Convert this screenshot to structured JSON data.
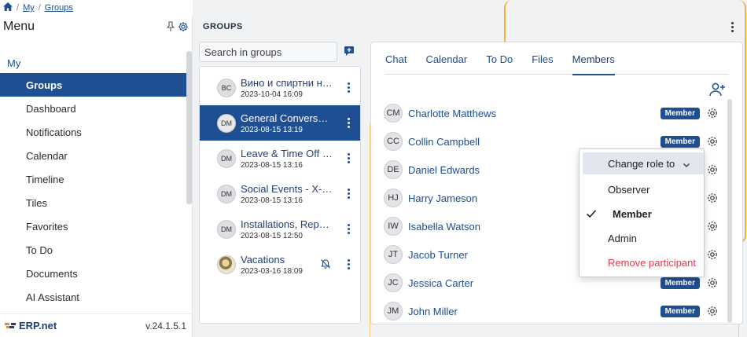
{
  "breadcrumb": {
    "home_icon": "home-icon",
    "items": [
      "My",
      "Groups"
    ],
    "separator": "/"
  },
  "sidebar": {
    "title": "Menu",
    "section": "My",
    "items": [
      {
        "label": "Groups",
        "active": true
      },
      {
        "label": "Dashboard"
      },
      {
        "label": "Notifications"
      },
      {
        "label": "Calendar"
      },
      {
        "label": "Timeline"
      },
      {
        "label": "Tiles"
      },
      {
        "label": "Favorites"
      },
      {
        "label": "To Do"
      },
      {
        "label": "Documents"
      },
      {
        "label": "AI Assistant"
      }
    ],
    "logo": "ERP.net",
    "version": "v.24.1.5.1"
  },
  "groups": {
    "title": "GROUPS",
    "search_placeholder": "Search in groups",
    "items": [
      {
        "avatar": "BC",
        "name": "Вино и спиртни напитки",
        "time": "2023-10-04 16:09"
      },
      {
        "avatar": "DM",
        "name": "General Conversation",
        "time": "2023-08-15 13:19",
        "active": true
      },
      {
        "avatar": "DM",
        "name": "Leave & Time Off - Requests",
        "time": "2023-08-15 13:16"
      },
      {
        "avatar": "DM",
        "name": "Social Events - X-Team",
        "time": "2023-08-15 13:16"
      },
      {
        "avatar": "DM",
        "name": "Installations, Repairs",
        "time": "2023-08-15 12:50"
      },
      {
        "avatar": "",
        "name": "Vacations",
        "time": "2023-03-16 18:09",
        "muted": true
      }
    ]
  },
  "tabs": [
    "Chat",
    "Calendar",
    "To Do",
    "Files",
    "Members"
  ],
  "active_tab": "Members",
  "members": [
    {
      "initials": "CM",
      "name": "Charlotte Matthews",
      "role": "Member"
    },
    {
      "initials": "CC",
      "name": "Collin Campbell",
      "role": "Member"
    },
    {
      "initials": "DE",
      "name": "Daniel Edwards",
      "role": ""
    },
    {
      "initials": "HJ",
      "name": "Harry Jameson",
      "role": ""
    },
    {
      "initials": "IW",
      "name": "Isabella Watson",
      "role": ""
    },
    {
      "initials": "JT",
      "name": "Jacob Turner",
      "role": ""
    },
    {
      "initials": "JC",
      "name": "Jessica Carter",
      "role": "Member"
    },
    {
      "initials": "JM",
      "name": "John Miller",
      "role": "Member"
    }
  ],
  "role_menu": {
    "header": "Change role to",
    "options": [
      "Observer",
      "Member",
      "Admin"
    ],
    "selected": "Member",
    "remove": "Remove participant"
  },
  "colors": {
    "primary": "#1f4f93",
    "danger": "#e03c4e",
    "accent_frame": "#f4b13a"
  }
}
